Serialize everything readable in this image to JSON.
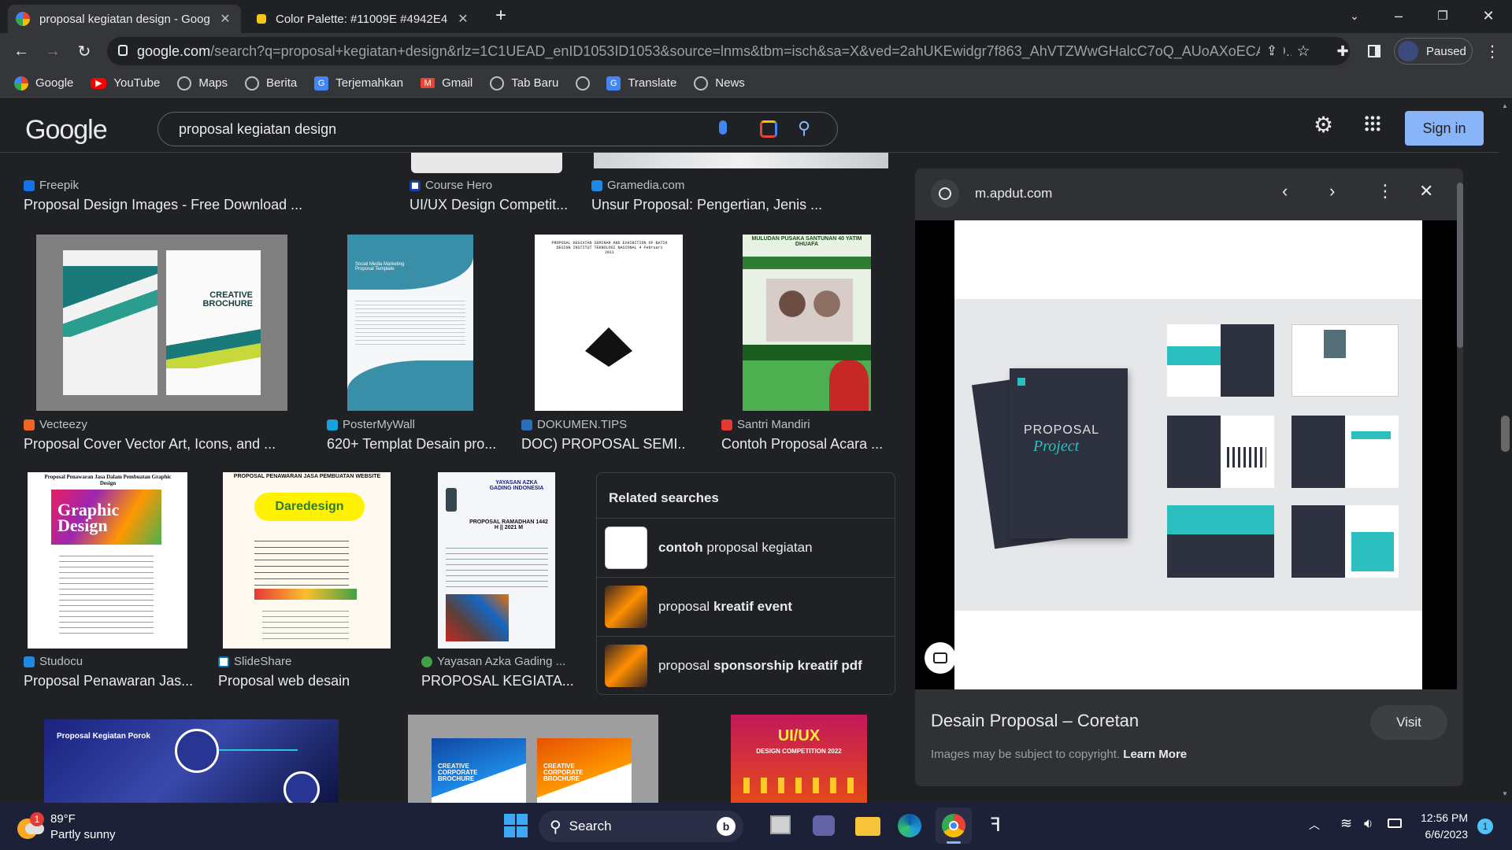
{
  "browser": {
    "tabs": [
      {
        "title": "proposal kegiatan design - Goog",
        "active": true
      },
      {
        "title": "Color Palette: #11009E #4942E4",
        "active": false
      }
    ],
    "url_host": "google.com",
    "url_rest": "/search?q=proposal+kegiatan+design&rlz=1C1UEAD_enID1053ID1053&source=lnms&tbm=isch&sa=X&ved=2ahUKEwidgr7f863_AhVTZWwGHalcC7oQ_AUoAXoECAEQ...",
    "profile_label": "Paused",
    "bookmarks": [
      "Google",
      "YouTube",
      "Maps",
      "Berita",
      "Terjemahkan",
      "Gmail",
      "Tab Baru",
      "",
      "Translate",
      "News"
    ]
  },
  "google": {
    "logo": "Google",
    "query": "proposal kegiatan design",
    "signin_label": "Sign in"
  },
  "results": [
    {
      "source": "Freepik",
      "title": "Proposal Design Images - Free Download ..."
    },
    {
      "source": "Course Hero",
      "title": "UI/UX Design Competit..."
    },
    {
      "source": "Gramedia.com",
      "title": "Unsur Proposal: Pengertian, Jenis ..."
    },
    {
      "source": "Vecteezy",
      "title": "Proposal Cover Vector Art, Icons, and ..."
    },
    {
      "source": "PosterMyWall",
      "title": "620+ Templat Desain pro..."
    },
    {
      "source": "DOKUMEN.TIPS",
      "title": "DOC) PROPOSAL SEMI..."
    },
    {
      "source": "Santri Mandiri",
      "title": "Contoh Proposal Acara ..."
    },
    {
      "source": "Studocu",
      "title": "Proposal Penawaran Jas..."
    },
    {
      "source": "SlideShare",
      "title": "Proposal web desain"
    },
    {
      "source": "Yayasan Azka Gading ...",
      "title": "PROPOSAL KEGIATA..."
    }
  ],
  "thumb_text": {
    "brochure": "CREATIVE BROCHURE",
    "social": "Social Media Marketing Proposal Template",
    "doc_head": "PROPOSAL KEGIATAN SEMINAR AND EXHIBITION OF BATIK DESIGN INSTITUT TEKNOLOGI NASIONAL 4 Februari 2011",
    "santri_head": "MULUDAN PUSAKA SANTUNAN 40 YATIM DHUAFA",
    "penawaran_head": "Proposal Penawaran Jasa Dalam Pembuatan Graphic Design",
    "graphic": "Graphic Design",
    "web_head": "PROPOSAL PENAWARAN JASA PEMBUATAN WEBSITE",
    "daredesign": "Daredesign",
    "ramadhan": "PROPOSAL RAMADHAN 1442 H || 2021 M",
    "yayasan": "YAYASAN AZKA GADING INDONESIA",
    "porok": "Proposal Kegiatan Porok",
    "corporate": "CREATIVE CORPORATE BROCHURE",
    "uiux": "UI/UX",
    "uiux_sub": "DESIGN COMPETITION 2022"
  },
  "related": {
    "heading": "Related searches",
    "items": [
      {
        "bold": "contoh",
        "normal": " proposal kegiatan",
        "bold_first": true
      },
      {
        "normal": "proposal ",
        "bold": "kreatif event",
        "bold_first": false
      },
      {
        "normal": "proposal ",
        "bold": "sponsorship kreatif pdf",
        "bold_first": false
      }
    ]
  },
  "panel": {
    "site": "m.apdut.com",
    "title": "Desain Proposal – Coretan",
    "visit_label": "Visit",
    "copyright": "Images may be subject to copyright.",
    "learn_more": "Learn More",
    "preview_title": "PROPOSAL",
    "preview_script": "Project"
  },
  "taskbar": {
    "temperature": "89°F",
    "weather": "Partly sunny",
    "search_label": "Search",
    "time": "12:56 PM",
    "date": "6/6/2023",
    "weather_badge": "1",
    "notif_badge": "1"
  },
  "colors": {
    "accent": "#8ab4f8",
    "bg": "#202124",
    "teal": "#2bbfbf"
  }
}
